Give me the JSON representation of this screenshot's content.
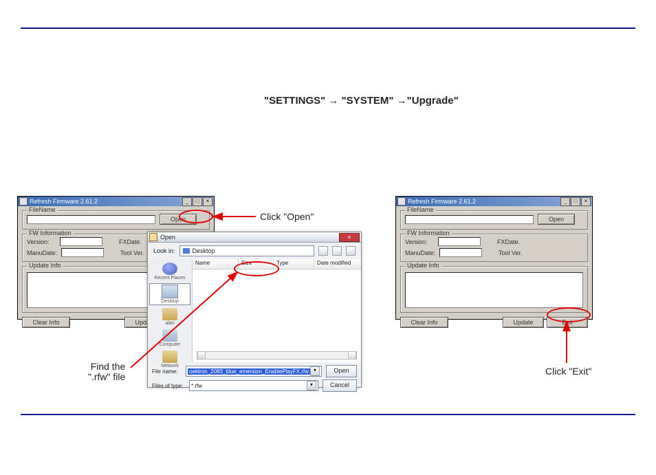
{
  "breadcrumb": "\"SETTINGS\" → \"SYSTEM\" →\"Upgrade\"",
  "fw": {
    "title": "Refresh Firmware 2.61.2",
    "group_fw": "FileName",
    "open_btn": "Open",
    "group_info": "FW Information",
    "version_lbl": "Version:",
    "manudate_lbl": "ManuDate:",
    "fxdate_lbl": "FXDate.",
    "toolver_lbl": "Tool Ver.",
    "update_info": "Update Info",
    "clear_btn": "Clear Info",
    "update_btn": "Update",
    "exit_btn": "Exit"
  },
  "open": {
    "title": "Open",
    "lookin_lbl": "Look in:",
    "lookin_value": "Desktop",
    "col_name": "Name",
    "col_size": "Size",
    "col_type": "Type",
    "col_date": "Date modified",
    "place_recent": "Recent Places",
    "place_desktop": "Desktop",
    "place_user": "alan",
    "place_computer": "Computer",
    "place_network": "Network",
    "filename_lbl": "File name:",
    "filename_val": "oektron_2083_blue_emersion_EnablePlayFX.rfw",
    "filetype_lbl": "Files of type:",
    "filetype_val": "*.rfw",
    "open_btn": "Open",
    "cancel_btn": "Cancel"
  },
  "callouts": {
    "click_open": "Click \"Open\"",
    "find_file_l1": "Find the",
    "find_file_l2": "\".rfw\" file",
    "click_exit": "Click \"Exit\""
  }
}
